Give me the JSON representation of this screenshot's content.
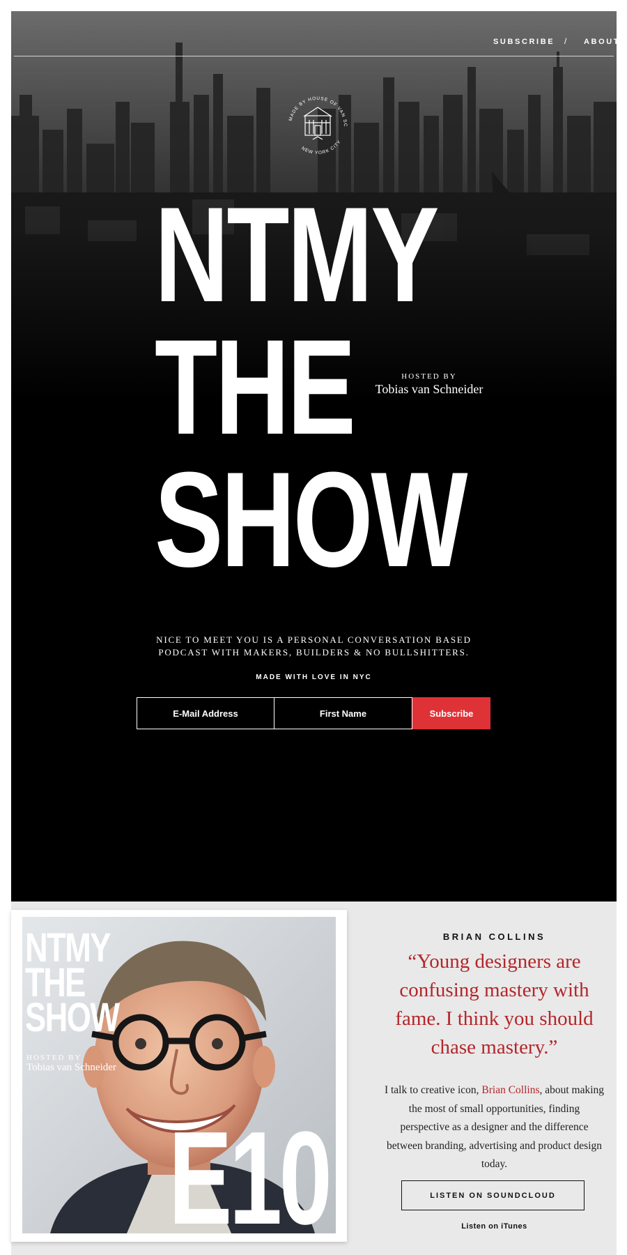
{
  "nav": {
    "subscribe": "SUBSCRIBE",
    "separator": "/",
    "about": "ABOUT"
  },
  "hero": {
    "title_lines": [
      "NTMY",
      "THE",
      "SHOW"
    ],
    "hosted_by_label": "HOSTED BY",
    "host_name": "Tobias van Schneider",
    "tagline_lines": [
      "NICE TO MEET YOU IS A PERSONAL CONVERSATION BASED",
      "PODCAST WITH MAKERS, BUILDERS & NO BULLSHITTERS."
    ],
    "made_with": "MADE WITH LOVE IN NYC",
    "badge_icon": "house-of-van-schneider-seal-icon"
  },
  "signup": {
    "email_placeholder": "E-Mail Address",
    "first_name_placeholder": "First Name",
    "submit_label": "Subscribe"
  },
  "episode": {
    "cover": {
      "title_lines": [
        "NTMY",
        "THE",
        "SHOW"
      ],
      "hosted_by_label": "HOSTED BY",
      "host_name": "Tobias van Schneider",
      "episode_number": "E10"
    },
    "guest_name": "BRIAN COLLINS",
    "quote_lines": [
      "“Young designers are",
      "confusing mastery with",
      "fame. I think you should",
      "chase mastery.”"
    ],
    "description": {
      "line1_before": "I talk to creative icon, ",
      "line1_link": "Brian Collins",
      "line1_after": ", about making",
      "line2": "the most of small opportunities, finding",
      "line3": "perspective as a designer and the difference",
      "line4": "between branding, advertising and product design",
      "line5": "today."
    },
    "soundcloud_label": "LISTEN ON SOUNDCLOUD",
    "itunes_label": "Listen on iTunes"
  },
  "colors": {
    "accent_red": "#df3237",
    "quote_red": "#b3262b",
    "hero_bg": "#000000",
    "episode_bg": "#e9e9e9"
  }
}
